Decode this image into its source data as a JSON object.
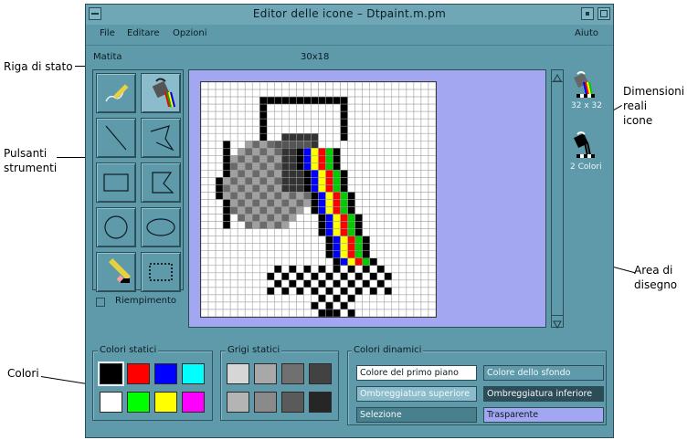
{
  "window": {
    "title": "Editor delle icone – Dtpaint.m.pm"
  },
  "menu": {
    "file": "File",
    "edit": "Editare",
    "options": "Opzioni",
    "help": "Aiuto"
  },
  "status": {
    "tool": "Matita",
    "size": "30x18"
  },
  "tools": {
    "fill_label": "Riempimento",
    "fill_checked": false
  },
  "preview": {
    "size_label": "32 x 32",
    "colors_label": "2 Colori"
  },
  "palettes": {
    "static_colors": {
      "label": "Colori statici",
      "colors": [
        "#000000",
        "#ff0000",
        "#0000ff",
        "#00ffff",
        "#ffffff",
        "#00ff00",
        "#ffff00",
        "#ff00ff"
      ]
    },
    "static_grays": {
      "label": "Grigi statici",
      "colors": [
        "#d6d6d6",
        "#a8a8a8",
        "#707070",
        "#424242",
        "#b4b4b4",
        "#8a8a8a",
        "#5a5a5a",
        "#262626"
      ]
    },
    "dynamic_colors": {
      "label": "Colori dinamici",
      "buttons": [
        "Colore del primo piano",
        "Colore dello sfondo",
        "Ombreggiatura superiore",
        "Ombreggiatura inferiore",
        "Selezione",
        "Trasparente"
      ]
    }
  },
  "annotations": {
    "status_row": "Riga di stato",
    "tool_buttons_1": "Pulsanti",
    "tool_buttons_2": "strumenti",
    "colors": "Colori",
    "real_size_1": "Dimensioni",
    "real_size_2": "reali",
    "real_size_3": "icone",
    "draw_area_1": "Area di",
    "draw_area_2": "disegno"
  }
}
